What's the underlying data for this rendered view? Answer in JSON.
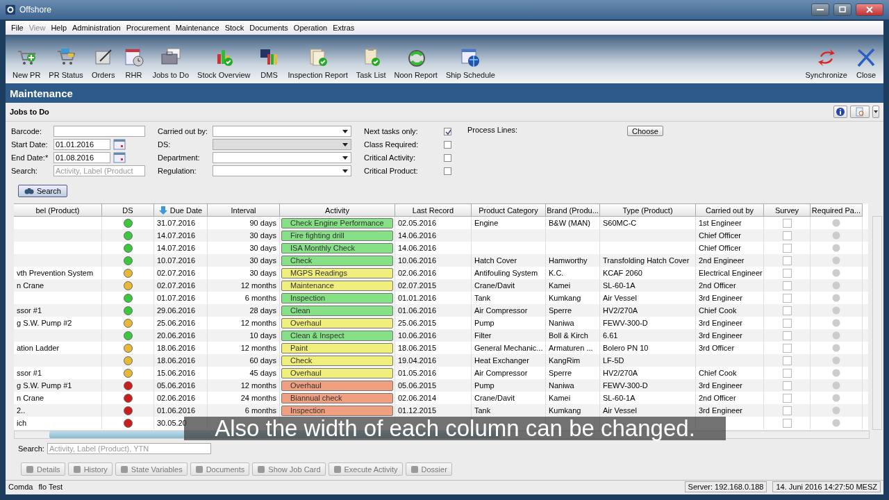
{
  "window": {
    "title": "Offshore"
  },
  "menu": [
    {
      "label": "File",
      "disabled": false
    },
    {
      "label": "View",
      "disabled": true
    },
    {
      "label": "Help",
      "disabled": false
    },
    {
      "label": "Administration",
      "disabled": false
    },
    {
      "label": "Procurement",
      "disabled": false
    },
    {
      "label": "Maintenance",
      "disabled": false
    },
    {
      "label": "Stock",
      "disabled": false
    },
    {
      "label": "Documents",
      "disabled": false
    },
    {
      "label": "Operation",
      "disabled": false
    },
    {
      "label": "Extras",
      "disabled": false
    }
  ],
  "toolbar": {
    "left": [
      {
        "label": "New PR"
      },
      {
        "label": "PR Status"
      },
      {
        "label": "Orders"
      },
      {
        "label": "RHR"
      },
      {
        "label": "Jobs to Do"
      },
      {
        "label": "Stock Overview"
      },
      {
        "label": "DMS"
      },
      {
        "label": "Inspection Report"
      },
      {
        "label": "Task List"
      },
      {
        "label": "Noon Report"
      },
      {
        "label": "Ship Schedule"
      }
    ],
    "right": [
      {
        "label": "Synchronize"
      },
      {
        "label": "Close"
      }
    ]
  },
  "section_title": "Maintenance",
  "panel_title": "Jobs to Do",
  "filters": {
    "col1": [
      {
        "label": "Barcode:",
        "kind": "text"
      },
      {
        "label": "Start Date:",
        "kind": "date",
        "value": "01.01.2016"
      },
      {
        "label": "End Date:*",
        "kind": "date",
        "value": "01.08.2016"
      },
      {
        "label": "Search:",
        "kind": "text",
        "placeholder": "Activity, Label (Product"
      }
    ],
    "col2": [
      {
        "label": "Carried out by:",
        "disabled": false
      },
      {
        "label": "DS:",
        "disabled": true
      },
      {
        "label": "Department:",
        "disabled": false
      },
      {
        "label": "Regulation:",
        "disabled": false
      }
    ],
    "col3": [
      {
        "label": "Next tasks only:",
        "checked": true
      },
      {
        "label": "Class Required:",
        "checked": false
      },
      {
        "label": "Critical Activity:",
        "checked": false
      },
      {
        "label": "Critical Product:",
        "checked": false
      }
    ],
    "process_lines": {
      "label": "Process Lines:",
      "button": "Choose"
    },
    "search_button": "Search"
  },
  "table": {
    "columns": [
      {
        "label": "bel (Product)",
        "sorted": false
      },
      {
        "label": "DS",
        "sorted": false
      },
      {
        "label": "Due Date",
        "sorted": true
      },
      {
        "label": "Interval",
        "sorted": false
      },
      {
        "label": "Activity",
        "sorted": false
      },
      {
        "label": "Last Record",
        "sorted": false
      },
      {
        "label": "Product Category",
        "sorted": false
      },
      {
        "label": "Brand (Produ...",
        "sorted": false
      },
      {
        "label": "Type (Product)",
        "sorted": false
      },
      {
        "label": "Carried out by",
        "sorted": false
      },
      {
        "label": "Survey",
        "sorted": false
      },
      {
        "label": "Required Pa...",
        "sorted": false
      }
    ],
    "rows": [
      {
        "due": "31.07.2016",
        "ds": {
          "color": "#3cc83c"
        },
        "interval": "90 days",
        "activity": {
          "text": "Check Engine Performance",
          "color": "#86e086"
        },
        "last": "02.05.2016",
        "category": "Engine",
        "brand": "B&W   (MAN)",
        "type": "S60MC-C",
        "carried_by": "1st Engineer",
        "survey_checked": false
      },
      {
        "due": "14.07.2016",
        "ds": {
          "color": "#3cc83c"
        },
        "interval": "30 days",
        "activity": {
          "text": "Fire fighting drill",
          "color": "#86e086"
        },
        "last": "14.06.2016",
        "carried_by": "Chief Officer",
        "survey_checked": false
      },
      {
        "due": "14.07.2016",
        "ds": {
          "color": "#3cc83c"
        },
        "interval": "30 days",
        "activity": {
          "text": "ISA Monthly Check",
          "color": "#86e086"
        },
        "last": "14.06.2016",
        "carried_by": "Chief Officer",
        "survey_checked": false
      },
      {
        "due": "10.07.2016",
        "ds": {
          "color": "#3cc83c"
        },
        "interval": "30 days",
        "activity": {
          "text": "Check",
          "color": "#86e086"
        },
        "last": "10.06.2016",
        "category": "Hatch Cover",
        "brand": "Hamworthy",
        "type": "Transfolding Hatch Cover",
        "carried_by": "2nd Engineer",
        "survey_checked": false
      },
      {
        "label": "vth Prevention System",
        "due": "02.07.2016",
        "ds": {
          "color": "#e8b838"
        },
        "interval": "30 days",
        "activity": {
          "text": "MGPS Readings",
          "color": "#f0ee7c"
        },
        "last": "02.06.2016",
        "category": "Antifouling System",
        "brand": "K.C.",
        "type": "KCAF 2060",
        "carried_by": "Electrical Engineer",
        "survey_checked": false
      },
      {
        "label": "n Crane",
        "due": "02.07.2016",
        "ds": {
          "color": "#e8b838"
        },
        "interval": "12 months",
        "activity": {
          "text": "Maintenance",
          "color": "#f0ee7c"
        },
        "last": "02.07.2015",
        "category": "Crane/Davit",
        "brand": "Kamei",
        "type": "SL-60-1A",
        "carried_by": "2nd Officer",
        "survey_checked": false
      },
      {
        "due": "01.07.2016",
        "ds": {
          "color": "#3cc83c"
        },
        "interval": "6 months",
        "activity": {
          "text": "Inspection",
          "color": "#86e086"
        },
        "last": "01.01.2016",
        "category": "Tank",
        "brand": "Kumkang",
        "type": "Air Vessel",
        "carried_by": "3rd Engineer",
        "survey_checked": false
      },
      {
        "label": "ssor #1",
        "due": "29.06.2016",
        "ds": {
          "color": "#3cc83c"
        },
        "interval": "28 days",
        "activity": {
          "text": "Clean",
          "color": "#86e086"
        },
        "last": "01.06.2016",
        "category": "Air Compressor",
        "brand": "Sperre",
        "type": "HV2/270A",
        "carried_by": "Chief Cook",
        "survey_checked": false
      },
      {
        "label": "g S.W. Pump #2",
        "due": "25.06.2016",
        "ds": {
          "color": "#e8b838"
        },
        "interval": "12 months",
        "activity": {
          "text": "Overhaul",
          "color": "#f0ee7c"
        },
        "last": "25.06.2015",
        "category": "Pump",
        "brand": "Naniwa",
        "type": "FEWV-300-D",
        "carried_by": "3rd Engineer",
        "survey_checked": false
      },
      {
        "due": "20.06.2016",
        "ds": {
          "color": "#3cc83c"
        },
        "interval": "10 days",
        "activity": {
          "text": "Clean & Inspect",
          "color": "#86e086"
        },
        "last": "10.06.2016",
        "category": "Filter",
        "brand": "Boll & Kirch",
        "type": "6.61",
        "carried_by": "3rd Engineer",
        "survey_checked": false
      },
      {
        "label": "ation Ladder",
        "due": "18.06.2016",
        "ds": {
          "color": "#e8b838"
        },
        "interval": "12 months",
        "activity": {
          "text": "Paint",
          "color": "#f0ee7c"
        },
        "last": "18.06.2015",
        "category": "General Mechanic...",
        "brand": "Armaturen ...",
        "type": "Bolero PN 10",
        "carried_by": "3rd Officer",
        "survey_checked": false
      },
      {
        "due": "18.06.2016",
        "ds": {
          "color": "#e8b838"
        },
        "interval": "60 days",
        "activity": {
          "text": "Check",
          "color": "#f0ee7c"
        },
        "last": "19.04.2016",
        "category": "Heat Exchanger",
        "brand": "KangRim",
        "type": "LF-5D",
        "survey_checked": false
      },
      {
        "label": "ssor #1",
        "due": "15.06.2016",
        "ds": {
          "color": "#e8b838"
        },
        "interval": "45 days",
        "activity": {
          "text": "Overhaul",
          "color": "#f0ee7c"
        },
        "last": "01.05.2016",
        "category": "Air Compressor",
        "brand": "Sperre",
        "type": "HV2/270A",
        "carried_by": "Chief Cook",
        "survey_checked": false
      },
      {
        "label": "g S.W. Pump #1",
        "due": "05.06.2016",
        "ds": {
          "color": "#c81e1e"
        },
        "interval": "12 months",
        "activity": {
          "text": "Overhaul",
          "color": "#f0a080"
        },
        "last": "05.06.2015",
        "category": "Pump",
        "brand": "Naniwa",
        "type": "FEWV-300-D",
        "carried_by": "3rd Engineer",
        "survey_checked": false
      },
      {
        "label": "n Crane",
        "due": "02.06.2016",
        "ds": {
          "color": "#c81e1e"
        },
        "interval": "24 months",
        "activity": {
          "text": "Biannual check",
          "color": "#f0a080"
        },
        "last": "02.06.2014",
        "category": "Crane/Davit",
        "brand": "Kamei",
        "type": "SL-60-1A",
        "carried_by": "2nd Officer",
        "survey_checked": false
      },
      {
        "label": "2..",
        "due": "01.06.2016",
        "ds": {
          "color": "#c81e1e"
        },
        "interval": "6 months",
        "activity": {
          "text": "Inspection",
          "color": "#f0a080"
        },
        "last": "01.12.2015",
        "category": "Tank",
        "brand": "Kumkang",
        "type": "Air Vessel",
        "carried_by": "3rd Engineer",
        "survey_checked": false
      },
      {
        "label": "ich",
        "due": "30.05.20",
        "ds": {
          "color": "#c81e1e"
        },
        "survey_checked": false
      }
    ]
  },
  "bottom_search": {
    "label": "Search:",
    "placeholder": "Activity, Label (Product), YTN"
  },
  "actions": [
    {
      "label": "Details",
      "disabled": true
    },
    {
      "label": "History",
      "disabled": true
    },
    {
      "label": "State Variables",
      "disabled": true
    },
    {
      "label": "Documents",
      "disabled": true
    },
    {
      "label": "Show Job Card",
      "disabled": true
    },
    {
      "label": "Execute Activity",
      "disabled": true
    },
    {
      "label": "Dossier",
      "disabled": true
    }
  ],
  "status_bar": {
    "left": [
      "Comda",
      "flo Test"
    ],
    "right": [
      "Server: 192.168.0.188",
      "14. Juni 2016 14:27:50 MESZ"
    ]
  },
  "caption": "Also the width of each column can be changed."
}
